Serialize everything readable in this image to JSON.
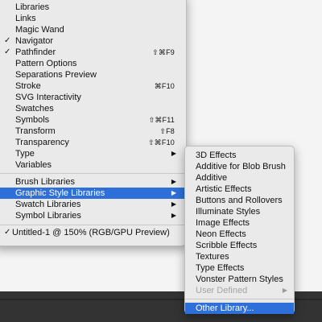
{
  "window_menu": {
    "items_top": [
      {
        "label": "Libraries",
        "checked": false,
        "shortcut": "",
        "submenu": false
      },
      {
        "label": "Links",
        "checked": false,
        "shortcut": "",
        "submenu": false
      },
      {
        "label": "Magic Wand",
        "checked": false,
        "shortcut": "",
        "submenu": false
      },
      {
        "label": "Navigator",
        "checked": true,
        "shortcut": "",
        "submenu": false
      },
      {
        "label": "Pathfinder",
        "checked": true,
        "shortcut": "⇧⌘F9",
        "submenu": false
      },
      {
        "label": "Pattern Options",
        "checked": false,
        "shortcut": "",
        "submenu": false
      },
      {
        "label": "Separations Preview",
        "checked": false,
        "shortcut": "",
        "submenu": false
      },
      {
        "label": "Stroke",
        "checked": false,
        "shortcut": "⌘F10",
        "submenu": false
      },
      {
        "label": "SVG Interactivity",
        "checked": false,
        "shortcut": "",
        "submenu": false
      },
      {
        "label": "Swatches",
        "checked": false,
        "shortcut": "",
        "submenu": false
      },
      {
        "label": "Symbols",
        "checked": false,
        "shortcut": "⇧⌘F11",
        "submenu": false
      },
      {
        "label": "Transform",
        "checked": false,
        "shortcut": "⇧F8",
        "submenu": false
      },
      {
        "label": "Transparency",
        "checked": false,
        "shortcut": "⇧⌘F10",
        "submenu": false
      },
      {
        "label": "Type",
        "checked": false,
        "shortcut": "",
        "submenu": true
      },
      {
        "label": "Variables",
        "checked": false,
        "shortcut": "",
        "submenu": false
      }
    ],
    "items_libraries": [
      {
        "label": "Brush Libraries",
        "submenu": true,
        "highlighted": false
      },
      {
        "label": "Graphic Style Libraries",
        "submenu": true,
        "highlighted": true
      },
      {
        "label": "Swatch Libraries",
        "submenu": true,
        "highlighted": false
      },
      {
        "label": "Symbol Libraries",
        "submenu": true,
        "highlighted": false
      }
    ],
    "document_item": {
      "label": "Untitled-1 @ 150% (RGB/GPU Preview)",
      "checked": true
    }
  },
  "graphic_style_submenu": {
    "items": [
      {
        "label": "3D Effects",
        "disabled": false,
        "submenu": false
      },
      {
        "label": "Additive for Blob Brush",
        "disabled": false,
        "submenu": false
      },
      {
        "label": "Additive",
        "disabled": false,
        "submenu": false
      },
      {
        "label": "Artistic Effects",
        "disabled": false,
        "submenu": false
      },
      {
        "label": "Buttons and Rollovers",
        "disabled": false,
        "submenu": false
      },
      {
        "label": "Illuminate Styles",
        "disabled": false,
        "submenu": false
      },
      {
        "label": "Image Effects",
        "disabled": false,
        "submenu": false
      },
      {
        "label": "Neon Effects",
        "disabled": false,
        "submenu": false
      },
      {
        "label": "Scribble Effects",
        "disabled": false,
        "submenu": false
      },
      {
        "label": "Textures",
        "disabled": false,
        "submenu": false
      },
      {
        "label": "Type Effects",
        "disabled": false,
        "submenu": false
      },
      {
        "label": "Vonster Pattern Styles",
        "disabled": false,
        "submenu": false
      },
      {
        "label": "User Defined",
        "disabled": true,
        "submenu": true
      }
    ],
    "other_library": {
      "label": "Other Library...",
      "highlighted": true
    }
  },
  "glyphs": {
    "check": "✓",
    "arrow": "▶"
  },
  "colors": {
    "highlight": "#2f6fd9",
    "menu_bg": "#eaeaea",
    "disabled_text": "#a3a3a3",
    "bottom_band": "#333333"
  }
}
